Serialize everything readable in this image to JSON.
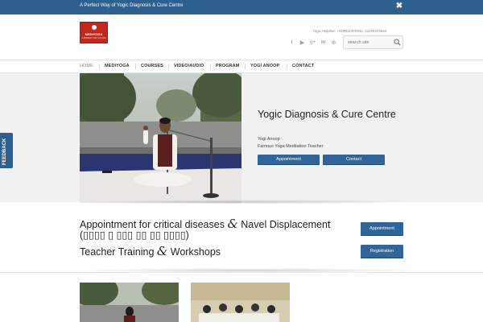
{
  "topbar": {
    "message": "A Perfect Way of Yogic Diagnosis & Cure Centre",
    "close_glyph": "✖"
  },
  "header": {
    "logo_text": "MEDIYOGA",
    "logo_tagline": "A PERFECT WAY OF LIFE",
    "helpline": "Yoga Helpline: +919811455544, 01145415844",
    "social": [
      "facebook-icon",
      "youtube-icon",
      "google-plus-icon",
      "linkedin-icon",
      "tripadvisor-icon"
    ],
    "social_glyphs": [
      "f",
      "▶",
      "g+",
      "in",
      "⊕"
    ],
    "search_placeholder": "search site"
  },
  "nav": {
    "items": [
      {
        "label": "HOME",
        "active": true
      },
      {
        "label": "MEDIYOGA",
        "active": false
      },
      {
        "label": "COURSES",
        "active": false
      },
      {
        "label": "VIDEO/AUDIO",
        "active": false
      },
      {
        "label": "PROGRAM",
        "active": false
      },
      {
        "label": "YOGI ANOOP",
        "active": false
      },
      {
        "label": "CONTACT",
        "active": false
      }
    ]
  },
  "hero": {
    "title": "Yogic Diagnosis & Cure Centre",
    "name": "Yogi Anoop",
    "subtitle": "Famous Yoga Meditation Teacher",
    "appointment_label": "Appointment",
    "contact_label": "Contact"
  },
  "appointment": {
    "line1_a": "Appointment for critical diseases",
    "amp": "&",
    "line1_b": "Navel Displacement",
    "line2": "(▯▯▯▯ ▯ ▯▯▯ ▯▯ ▯▯ ▯▯▯▯)",
    "line3_a": "Teacher Training",
    "line3_b": "Workshops",
    "appointment_button": "Appointment",
    "registration_button": "Registration"
  },
  "feedback": {
    "label": "FEEDBACK"
  },
  "colors": {
    "brand_blue": "#2d5f8f",
    "button_blue": "#2f6598",
    "logo_red": "#c0281f"
  }
}
